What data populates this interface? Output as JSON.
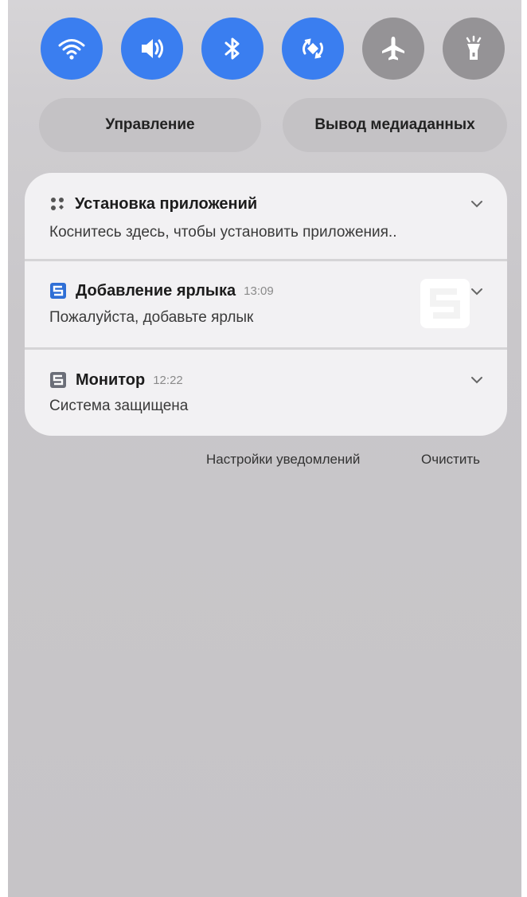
{
  "quick_toggles": [
    {
      "icon": "wifi-icon",
      "state": "on"
    },
    {
      "icon": "sound-icon",
      "state": "on"
    },
    {
      "icon": "bluetooth-icon",
      "state": "on"
    },
    {
      "icon": "auto-rotate-icon",
      "state": "on"
    },
    {
      "icon": "airplane-icon",
      "state": "off"
    },
    {
      "icon": "flashlight-icon",
      "state": "off"
    }
  ],
  "shortcuts": {
    "control_label": "Управление",
    "media_output_label": "Вывод медиаданных"
  },
  "notifications": [
    {
      "app_icon": "app-grid-icon",
      "title": "Установка приложений",
      "time": "",
      "body": "Коснитесь здесь, чтобы установить приложения.."
    },
    {
      "app_icon": "shortcut-app-icon",
      "title": "Добавление ярлыка",
      "time": "13:09",
      "body": "Пожалуйста, добавьте ярлык"
    },
    {
      "app_icon": "monitor-app-icon",
      "title": "Монитор",
      "time": "12:22",
      "body": "Система защищена"
    }
  ],
  "footer": {
    "settings_label": "Настройки уведомлений",
    "clear_label": "Очистить"
  },
  "colors": {
    "toggle_on": "#3a7ef0",
    "toggle_off": "#959396",
    "app_icon_blue": "#2f6fd6",
    "app_icon_gray": "#6b6e78"
  }
}
